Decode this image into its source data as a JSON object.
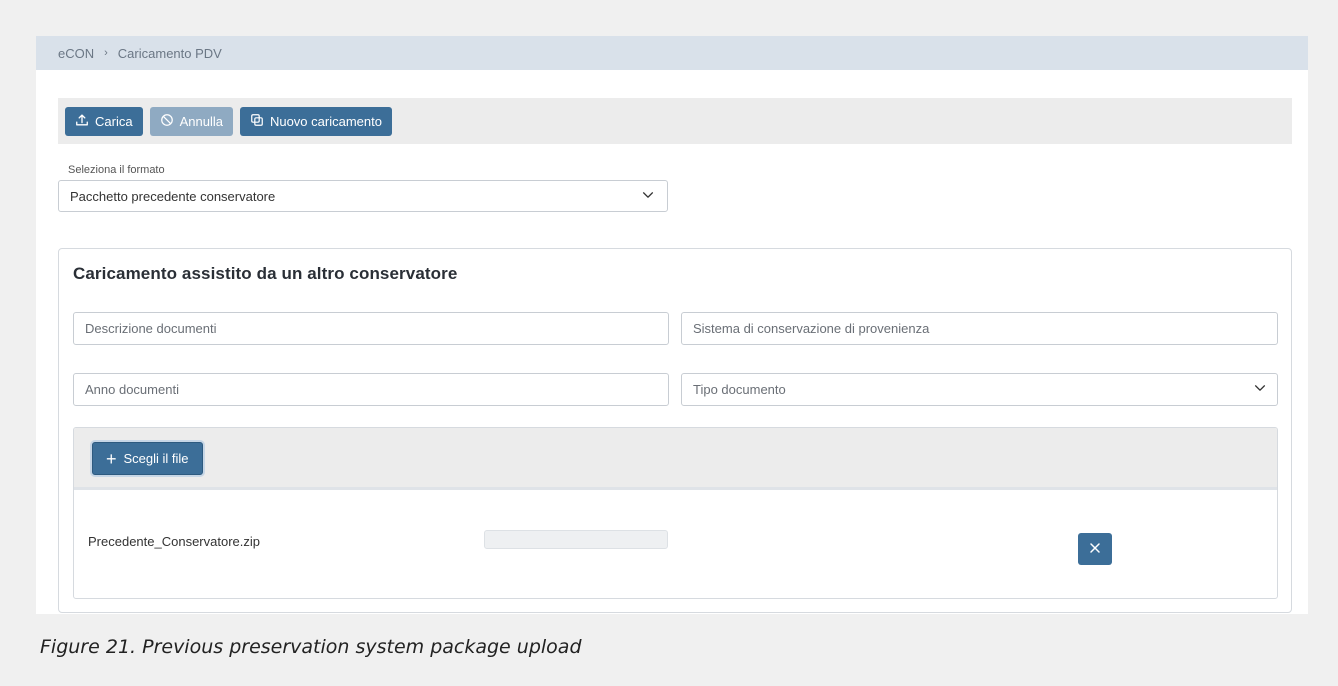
{
  "breadcrumb": {
    "root": "eCON",
    "separator": "›",
    "current": "Caricamento PDV"
  },
  "toolbar": {
    "carica_label": "Carica",
    "annulla_label": "Annulla",
    "nuovo_label": "Nuovo caricamento"
  },
  "format": {
    "label": "Seleziona il formato",
    "selected": "Pacchetto precedente conservatore"
  },
  "card": {
    "title": "Caricamento assistito da un altro conservatore",
    "fields": {
      "descrizione_placeholder": "Descrizione documenti",
      "sistema_placeholder": "Sistema di conservazione di provenienza",
      "anno_placeholder": "Anno documenti",
      "tipo_placeholder": "Tipo documento"
    },
    "upload": {
      "choose_label": "Scegli il file",
      "file_name": "Precedente_Conservatore.zip",
      "progress": 0
    }
  },
  "caption": "Figure 21. Previous preservation system package upload",
  "colors": {
    "primary": "#3c6e98",
    "primary_disabled": "#8faac2",
    "breadcrumb_bg": "#d9e1ea",
    "toolbar_bg": "#ececec"
  },
  "icons": {
    "carica": "upload-icon",
    "annulla": "ban-icon",
    "nuovo": "copy-icon",
    "choose": "plus-icon",
    "remove": "close-icon",
    "dropdown": "chevron-down-icon"
  }
}
